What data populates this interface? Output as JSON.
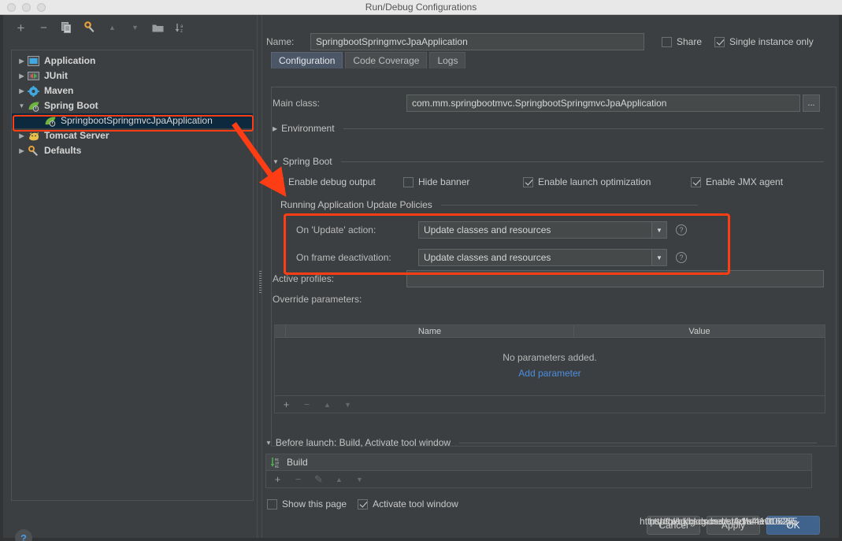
{
  "window": {
    "title": "Run/Debug Configurations",
    "accent_red": "#ff3d14",
    "accent_blue": "#4a8fe0",
    "panel_bg": "#3c3f41"
  },
  "left": {
    "toolbar": [
      {
        "name": "add-icon",
        "glyph": "+"
      },
      {
        "name": "remove-icon",
        "glyph": "−"
      },
      {
        "name": "copy-icon",
        "glyph": "❐"
      },
      {
        "name": "edit-templates-icon",
        "glyph": "⚙"
      },
      {
        "name": "move-up-icon",
        "glyph": "▲"
      },
      {
        "name": "move-down-icon",
        "glyph": "▼"
      },
      {
        "name": "folder-icon",
        "glyph": "▰"
      },
      {
        "name": "sort-alphabetically-icon",
        "glyph": "↓"
      }
    ],
    "tree": [
      {
        "label": "Application",
        "expanded": false,
        "selected": false,
        "child": false,
        "icon": "application-icon",
        "icon_color": "#6cb7e8"
      },
      {
        "label": "JUnit",
        "expanded": false,
        "selected": false,
        "child": false,
        "icon": "junit-icon",
        "icon_color": "#d35f5f"
      },
      {
        "label": "Maven",
        "expanded": false,
        "selected": false,
        "child": false,
        "icon": "maven-icon",
        "icon_color": "#3fa9e0"
      },
      {
        "label": "Spring Boot",
        "expanded": true,
        "selected": false,
        "child": false,
        "icon": "spring-boot-icon",
        "icon_color": "#6db33f"
      },
      {
        "label": "SpringbootSpringmvcJpaApplication",
        "expanded": false,
        "selected": true,
        "child": true,
        "icon": "spring-boot-icon",
        "icon_color": "#6db33f"
      },
      {
        "label": "Tomcat Server",
        "expanded": false,
        "selected": false,
        "child": false,
        "icon": "tomcat-icon",
        "icon_color": "#e8c04a"
      },
      {
        "label": "Defaults",
        "expanded": false,
        "selected": false,
        "child": false,
        "icon": "defaults-icon",
        "icon_color": "#e8a13a"
      }
    ],
    "help_button": "?"
  },
  "header": {
    "name_label": "Name:",
    "name_value": "SpringbootSpringmvcJpaApplication",
    "share": {
      "label": "Share",
      "checked": false
    },
    "single_instance": {
      "label": "Single instance only",
      "checked": true
    }
  },
  "tabs": [
    {
      "label": "Configuration",
      "active": true
    },
    {
      "label": "Code Coverage",
      "active": false
    },
    {
      "label": "Logs",
      "active": false
    }
  ],
  "configuration": {
    "main_class_label": "Main class:",
    "main_class_value": "com.mm.springbootmvc.SpringbootSpringmvcJpaApplication",
    "browse_button": "...",
    "environment_section": "Environment",
    "spring_boot_section": "Spring Boot",
    "spring_boot_options": [
      {
        "label": "Enable debug output",
        "checked": false
      },
      {
        "label": "Hide banner",
        "checked": false
      },
      {
        "label": "Enable launch optimization",
        "checked": true
      },
      {
        "label": "Enable JMX agent",
        "checked": true
      }
    ],
    "update_policies_section": "Running Application Update Policies",
    "update_policies": [
      {
        "label": "On 'Update' action:",
        "value": "Update classes and resources",
        "help": "?"
      },
      {
        "label": "On frame deactivation:",
        "value": "Update classes and resources",
        "help": "?"
      }
    ],
    "active_profiles_label": "Active profiles:",
    "active_profiles_value": "",
    "override_parameters_label": "Override parameters:",
    "param_table": {
      "columns": [
        "",
        "Name",
        "Value"
      ],
      "rows": [],
      "empty_text": "No parameters added.",
      "add_link": "Add parameter",
      "toolbar": [
        {
          "name": "add-parameter-icon",
          "glyph": "+",
          "enabled": true
        },
        {
          "name": "remove-parameter-icon",
          "glyph": "−",
          "enabled": false
        },
        {
          "name": "move-parameter-up-icon",
          "glyph": "▲",
          "enabled": false
        },
        {
          "name": "move-parameter-down-icon",
          "glyph": "▼",
          "enabled": false
        }
      ]
    }
  },
  "before_launch": {
    "section_title": "Before launch: Build, Activate tool window",
    "items": [
      {
        "label": "Build",
        "icon": "build-icon"
      }
    ],
    "toolbar": [
      {
        "name": "add-task-icon",
        "glyph": "+",
        "enabled": true
      },
      {
        "name": "remove-task-icon",
        "glyph": "−",
        "enabled": false
      },
      {
        "name": "edit-task-icon",
        "glyph": "✎",
        "enabled": false
      },
      {
        "name": "move-task-up-icon",
        "glyph": "▲",
        "enabled": false
      },
      {
        "name": "move-task-down-icon",
        "glyph": "▼",
        "enabled": false
      }
    ],
    "show_this_page": {
      "label": "Show this page",
      "checked": false
    },
    "activate_tool_window": {
      "label": "Activate tool window",
      "checked": true
    }
  },
  "footer": {
    "buttons": [
      {
        "label": "Cancel",
        "primary": false
      },
      {
        "label": "Apply",
        "primary": false
      },
      {
        "label": "OK",
        "primary": true
      }
    ],
    "watermark_lines": [
      "https://blog.csdn.net/si4chen1016265",
      "https://blog.csdn.net/s1h4en10625",
      "https://blog.csdn.net/sl4e1t0k2y5"
    ]
  }
}
